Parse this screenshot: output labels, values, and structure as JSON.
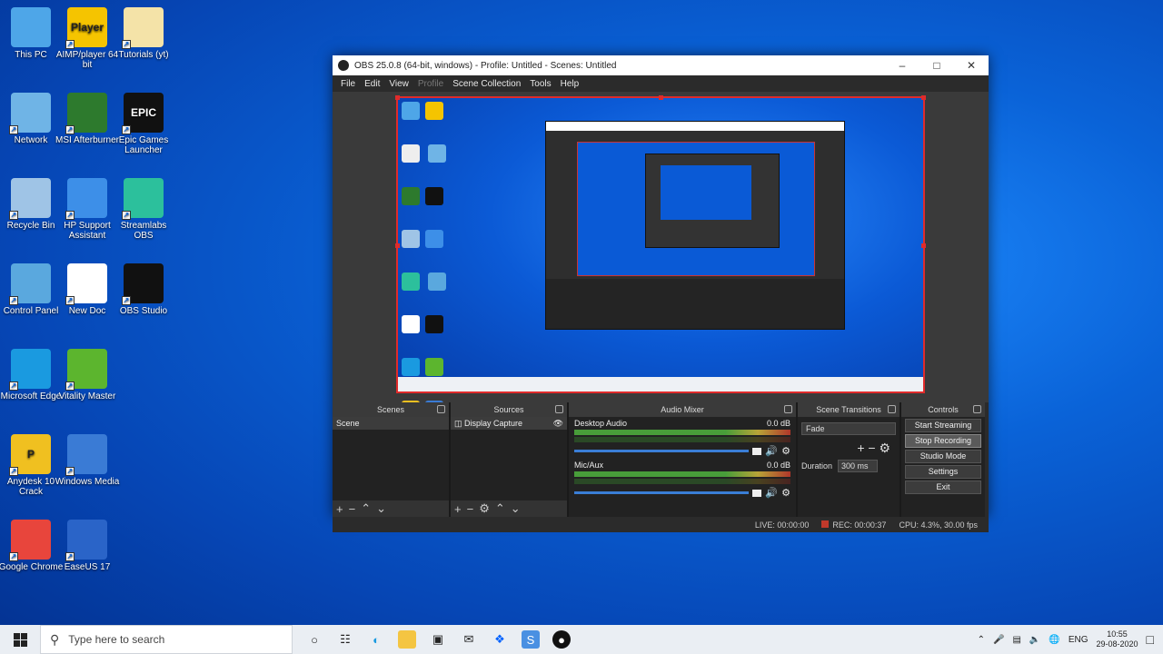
{
  "desktop_icons": [
    {
      "id": "this-pc",
      "label": "This PC",
      "color": "#4ea6e8"
    },
    {
      "id": "aimp",
      "label": "AIMP/player 64 bit",
      "color": "#f5c400",
      "text": "Player"
    },
    {
      "id": "folder",
      "label": "Tutorials (yt)",
      "color": "#f4e3a8"
    },
    {
      "id": "network",
      "label": "Network",
      "color": "#6fb4e6"
    },
    {
      "id": "msi",
      "label": "MSI Afterburner",
      "color": "#2d7a2d"
    },
    {
      "id": "epic",
      "label": "Epic Games Launcher",
      "color": "#111",
      "text": "EPIC"
    },
    {
      "id": "recycle",
      "label": "Recycle Bin",
      "color": "#9fc4e6"
    },
    {
      "id": "hp",
      "label": "HP Support Assistant",
      "color": "#3d8fe8"
    },
    {
      "id": "streamlabs",
      "label": "Streamlabs OBS",
      "color": "#2cc09c"
    },
    {
      "id": "control-panel",
      "label": "Control Panel",
      "color": "#5aa8de"
    },
    {
      "id": "doc",
      "label": "New Doc",
      "color": "#ffffff"
    },
    {
      "id": "obs",
      "label": "OBS Studio",
      "color": "#111"
    },
    {
      "id": "edge",
      "label": "Microsoft Edge",
      "color": "#1a9ae0"
    },
    {
      "id": "vitality",
      "label": "Vitality Master",
      "color": "#5cb52e"
    },
    {
      "id": "ponder",
      "label": "Anydesk 10 Crack",
      "color": "#f0c020",
      "text": "P"
    },
    {
      "id": "wmp",
      "label": "Windows Media",
      "color": "#3a7bd5"
    },
    {
      "id": "chrome",
      "label": "Google Chrome",
      "color": "#e8453c"
    },
    {
      "id": "vscode",
      "label": "EaseUS 17",
      "color": "#2a64c8"
    }
  ],
  "obs": {
    "title": "OBS 25.0.8 (64-bit, windows) - Profile: Untitled - Scenes: Untitled",
    "menu": [
      "File",
      "Edit",
      "View",
      "Profile",
      "Scene Collection",
      "Tools",
      "Help"
    ],
    "docks": {
      "scenes": {
        "title": "Scenes",
        "items": [
          "Scene"
        ]
      },
      "sources": {
        "title": "Sources",
        "items": [
          "Display Capture"
        ]
      },
      "mixer": {
        "title": "Audio Mixer",
        "channels": [
          {
            "name": "Desktop Audio",
            "db": "0.0 dB"
          },
          {
            "name": "Mic/Aux",
            "db": "0.0 dB"
          }
        ]
      },
      "transitions": {
        "title": "Scene Transitions",
        "selected": "Fade",
        "duration_label": "Duration",
        "duration": "300 ms"
      },
      "controls": {
        "title": "Controls",
        "buttons": [
          "Start Streaming",
          "Stop Recording",
          "Studio Mode",
          "Settings",
          "Exit"
        ]
      }
    },
    "status": {
      "live": "LIVE: 00:00:00",
      "rec": "REC: 00:00:37",
      "cpu": "CPU: 4.3%, 30.00 fps"
    }
  },
  "taskbar": {
    "search_placeholder": "Type here to search",
    "tray_lang": "ENG",
    "time": "10:55",
    "date": "29-08-2020"
  }
}
